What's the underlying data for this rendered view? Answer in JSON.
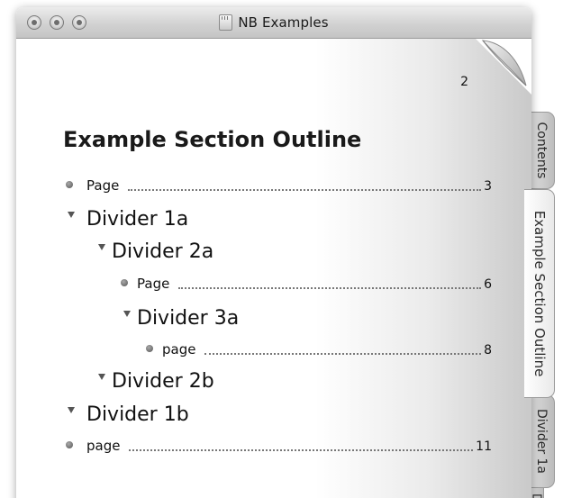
{
  "window": {
    "title": "NB Examples"
  },
  "page": {
    "number": "2"
  },
  "outline": {
    "title": "Example Section Outline",
    "items": [
      {
        "kind": "page",
        "label": "Page",
        "page": "3"
      },
      {
        "kind": "divider",
        "label": "Divider 1a"
      },
      {
        "kind": "divider",
        "label": "Divider 2a"
      },
      {
        "kind": "page",
        "label": "Page",
        "page": "6"
      },
      {
        "kind": "divider",
        "label": "Divider 3a"
      },
      {
        "kind": "page",
        "label": "page",
        "page": "8"
      },
      {
        "kind": "divider",
        "label": "Divider 2b"
      },
      {
        "kind": "divider",
        "label": "Divider 1b"
      },
      {
        "kind": "page",
        "label": "page",
        "page": "11"
      }
    ]
  },
  "tabs": [
    {
      "label": "Contents"
    },
    {
      "label": "Example Section Outline"
    },
    {
      "label": "Divider 1a"
    },
    {
      "label": "D"
    }
  ],
  "icons": {
    "window_controls": [
      "close-icon",
      "minimize-icon",
      "zoom-icon"
    ],
    "title_icon": "notebook-document-icon",
    "page_marker": "bullet-icon",
    "divider_marker": "disclosure-triangle-icon",
    "corner": "page-curl-icon"
  },
  "colors": {
    "titlebar": "#d2d2d2",
    "page": "#ffffff",
    "tab": "#d8d8d8",
    "active_tab": "#f2f2f2",
    "text": "#111111"
  }
}
